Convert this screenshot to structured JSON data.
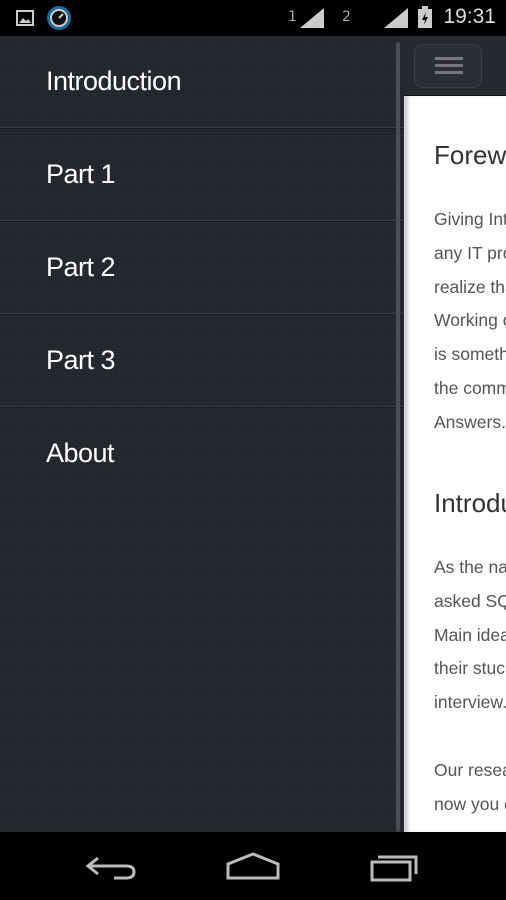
{
  "status_bar": {
    "time": "19:31",
    "sim1": "1",
    "sim2": "2",
    "icons": [
      "image-icon",
      "clock-app-icon",
      "signal-icon",
      "battery-charging-icon"
    ]
  },
  "drawer": {
    "items": [
      {
        "label": "Introduction"
      },
      {
        "label": "Part 1"
      },
      {
        "label": "Part 2"
      },
      {
        "label": "Part 3"
      },
      {
        "label": "About"
      }
    ]
  },
  "main": {
    "sections": [
      {
        "heading": "Forewor",
        "lines": [
          "Giving Inte",
          "any IT pro",
          "realize tha",
          "Working o",
          "is someth",
          "the comm",
          "Answers."
        ]
      },
      {
        "heading": "Introdu",
        "lines": [
          "As the nar",
          "asked SQL",
          "Main idea",
          "their stuc",
          "interview."
        ]
      },
      {
        "lines": [
          "Our resea",
          "now you c"
        ]
      }
    ]
  },
  "navbar": {
    "icons": [
      "back-icon",
      "home-icon",
      "recent-apps-icon"
    ]
  }
}
